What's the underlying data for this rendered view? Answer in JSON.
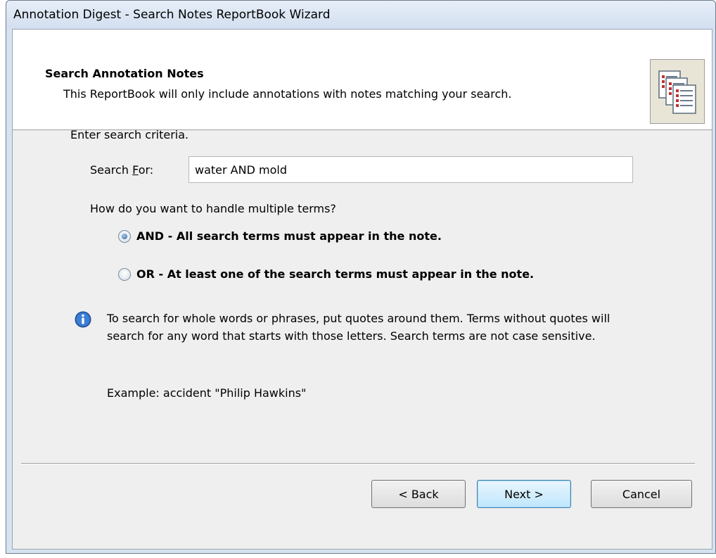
{
  "window": {
    "title": "Annotation Digest - Search Notes ReportBook Wizard"
  },
  "header": {
    "title": "Search Annotation Notes",
    "description": "This ReportBook will only include annotations with notes matching your search.",
    "icon": "reportbook-pages-icon"
  },
  "main": {
    "prompt": "Enter search criteria.",
    "search": {
      "label_prefix": "Search ",
      "label_accel": "F",
      "label_suffix": "or:",
      "value": "water AND mold"
    },
    "multi_terms_question": "How do you want to handle multiple terms?",
    "options": [
      {
        "label": "AND - All search terms must appear in the note.",
        "selected": true
      },
      {
        "label": "OR - At least one of the search terms must appear in the note.",
        "selected": false
      }
    ],
    "info_icon": "info-icon",
    "info_text": "To search for whole words or phrases, put quotes around them.  Terms without quotes will search for any word that starts with those letters. Search terms are not case sensitive.",
    "example": "Example: accident \"Philip Hawkins\""
  },
  "buttons": {
    "back": "< Back",
    "next": "Next >",
    "cancel": "Cancel"
  }
}
